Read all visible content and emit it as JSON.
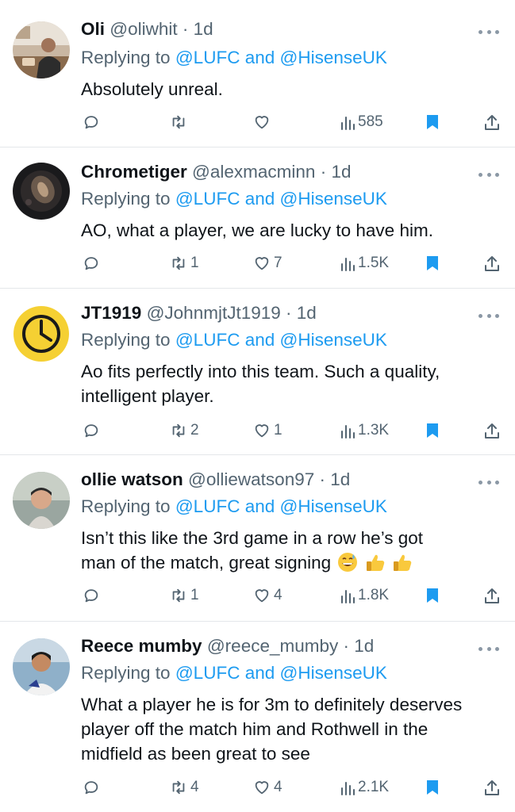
{
  "colors": {
    "accent": "#1d9bf0",
    "secondary_text": "#536471",
    "primary_text": "#0f1419",
    "divider": "#e4e7ea"
  },
  "tweets": [
    {
      "name": "Oli",
      "handle": "@oliwhit",
      "time": "· 1d",
      "reply_prefix": "Replying to",
      "mention1": "@LUFC",
      "reply_join": "and",
      "mention2": "@HisenseUK",
      "text_lines": [
        "Absolutely unreal."
      ],
      "reply_count": "",
      "retweet_count": "",
      "like_count": "",
      "view_count": "585"
    },
    {
      "name": "Chrometiger",
      "handle": "@alexmacminn",
      "time": "· 1d",
      "reply_prefix": "Replying to",
      "mention1": "@LUFC",
      "reply_join": "and",
      "mention2": "@HisenseUK",
      "text_lines": [
        "AO, what a player, we are lucky to have him."
      ],
      "reply_count": "",
      "retweet_count": "1",
      "like_count": "7",
      "view_count": "1.5K"
    },
    {
      "name": "JT1919",
      "handle": "@JohnmjtJt1919",
      "time": "· 1d",
      "reply_prefix": "Replying to",
      "mention1": "@LUFC",
      "reply_join": "and",
      "mention2": "@HisenseUK",
      "text_lines": [
        "Ao fits perfectly into this team. Such a quality,",
        "intelligent player."
      ],
      "reply_count": "",
      "retweet_count": "2",
      "like_count": "1",
      "view_count": "1.3K"
    },
    {
      "name": "ollie watson",
      "handle": "@olliewatson97",
      "time": "· 1d",
      "reply_prefix": "Replying to",
      "mention1": "@LUFC",
      "reply_join": "and",
      "mention2": "@HisenseUK",
      "text_lines": [
        "Isn’t this like the 3rd game in a row he’s got",
        "man of the match, great signing"
      ],
      "emojis": [
        "grinning-sweat-emoji",
        "thumbs-up-emoji",
        "thumbs-up-emoji"
      ],
      "reply_count": "",
      "retweet_count": "1",
      "like_count": "4",
      "view_count": "1.8K"
    },
    {
      "name": "Reece mumby",
      "handle": "@reece_mumby",
      "time": "· 1d",
      "reply_prefix": "Replying to",
      "mention1": "@LUFC",
      "reply_join": "and",
      "mention2": "@HisenseUK",
      "text_lines": [
        "What a player he is for 3m to definitely deserves",
        "player off the match him and Rothwell in the",
        "midfield as been great to see"
      ],
      "reply_count": "",
      "retweet_count": "4",
      "like_count": "4",
      "view_count": "2.1K"
    }
  ],
  "icons": {
    "reply": "reply-icon",
    "retweet": "retweet-icon",
    "like": "heart-icon",
    "views": "views-icon",
    "bookmark": "bookmark-icon",
    "share": "share-icon",
    "more": "more-icon"
  }
}
